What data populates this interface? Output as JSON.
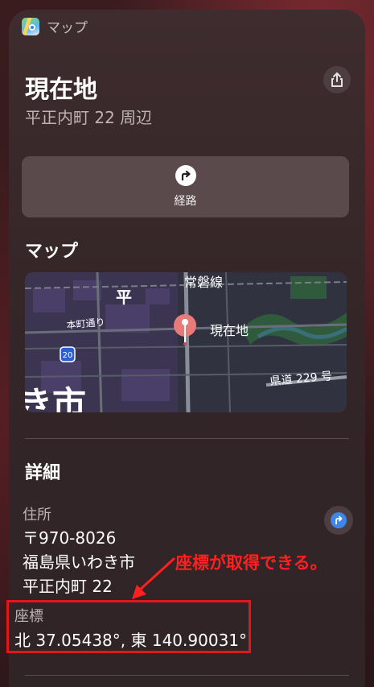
{
  "app": {
    "name": "マップ",
    "icon": "maps-app-icon"
  },
  "header": {
    "title": "現在地",
    "subtitle": "平正内町 22 周辺",
    "share_icon": "share-icon"
  },
  "route": {
    "label": "経路",
    "icon": "turn-arrow-icon"
  },
  "map_section": {
    "title": "マップ",
    "labels": {
      "district": "平",
      "rail_line": "常磐線",
      "street": "本町通り",
      "route_number": "20",
      "pin_label": "現在地",
      "prefectural_road": "県道 229 号",
      "city_partial": "き市"
    }
  },
  "details": {
    "title": "詳細",
    "address_label": "住所",
    "address_lines": [
      "〒970-8026",
      "福島県いわき市",
      "平正内町 22"
    ],
    "directions_icon": "directions-icon",
    "coordinate_label": "座標",
    "coordinate_value": "北 37.05438°, 東 140.90031°"
  },
  "annotation": {
    "text": "座標が取得できる。",
    "color": "#ff2020"
  },
  "colors": {
    "accent_blue": "#3e87e8",
    "pin_red": "#e87a7a",
    "highlight": "#e01818"
  }
}
